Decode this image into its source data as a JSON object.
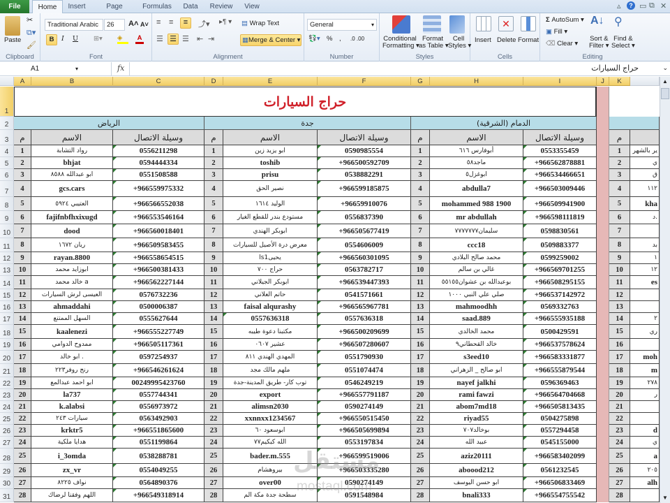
{
  "ribbon_tabs": [
    "File",
    "Home",
    "Insert",
    "Page Layout",
    "Formulas",
    "Data",
    "Review",
    "View"
  ],
  "active_tab": "Home",
  "clipboard": {
    "paste": "Paste",
    "label": "Clipboard"
  },
  "font": {
    "name": "Traditional Arabic",
    "size": "26",
    "label": "Font",
    "bold": "B",
    "italic": "I",
    "underline": "U",
    "grow": "A˄",
    "shrink": "A˅",
    "color": "A"
  },
  "alignment": {
    "wrap": "Wrap Text",
    "merge": "Merge & Center",
    "label": "Alignment"
  },
  "number": {
    "format": "General",
    "label": "Number",
    "percent": "%",
    "comma": ",",
    "inc": ".0 .00",
    "dec": ".00 .0"
  },
  "styles": {
    "conditional": "Conditional",
    "conditional2": "Formatting ▾",
    "format_table": "Format",
    "format_table2": "as Table ▾",
    "cell_styles": "Cell",
    "cell_styles2": "Styles ▾",
    "label": "Styles"
  },
  "cells": {
    "insert": "Insert",
    "delete": "Delete",
    "format": "Format",
    "label": "Cells"
  },
  "editing": {
    "autosum": "AutoSum ▾",
    "fill": "Fill ▾",
    "clear": "Clear ▾",
    "sort": "Sort &",
    "sort2": "Filter ▾",
    "find": "Find &",
    "find2": "Select ▾",
    "label": "Editing"
  },
  "formula_bar": {
    "name_box": "A1",
    "fx": "fx",
    "content": "حراج السيارات"
  },
  "columns": [
    "A",
    "B",
    "C",
    "D",
    "E",
    "F",
    "G",
    "H",
    "I",
    "J",
    "K"
  ],
  "sheet": {
    "title": "حراج السيارات",
    "headers": {
      "num": "م",
      "name": "الاسم",
      "contact": "وسيلة الاتصال"
    },
    "sections": [
      {
        "city": "الرياض",
        "rows": [
          [
            "1",
            "رواد التشابة",
            "0556211298"
          ],
          [
            "2",
            "bhjat",
            "0594444334"
          ],
          [
            "3",
            "ابو عبدالله ٨٥٨٨",
            "0551508588"
          ],
          [
            "4",
            "gcs.cars",
            "+966559975332"
          ],
          [
            "5",
            "العتيبي ٥٩٢٤",
            "+966566552038"
          ],
          [
            "6",
            "fajifnbfhxixugd",
            "+966553546164"
          ],
          [
            "7",
            "dood",
            "+966560018401"
          ],
          [
            "8",
            "ريان ١٦٧٢",
            "+966509583455"
          ],
          [
            "9",
            "rayan.8800",
            "+966558654515"
          ],
          [
            "10",
            "ابوزايد محمد",
            "+966500381433"
          ],
          [
            "11",
            "خالد محمد a",
            "+966562227144"
          ],
          [
            "12",
            "العيسى لرش السيارات",
            "0576732236"
          ],
          [
            "13",
            "ahmaddahi",
            "0500006387"
          ],
          [
            "14",
            "السهل الممتنع",
            "0555627644"
          ],
          [
            "15",
            "kaalenezi",
            "+966555227749"
          ],
          [
            "16",
            "ممدوح الدوامي",
            "+966505117361"
          ],
          [
            "17",
            "ابو خالد .",
            "0597254937"
          ],
          [
            "18",
            "رنج روفر٢٢٣",
            "+966546261624"
          ],
          [
            "19",
            "ابو احمد عبدالمع",
            "00249995423760"
          ],
          [
            "20",
            "la737",
            "0557744341"
          ],
          [
            "21",
            "k.alabsi",
            "0556973972"
          ],
          [
            "22",
            "سيارات ٢٤٣",
            "0563492903"
          ],
          [
            "23",
            "krktr5",
            "+966551865600"
          ],
          [
            "24",
            "هدايا ملكية",
            "0551199864"
          ],
          [
            "25",
            "i_3omda",
            "0538288781"
          ],
          [
            "26",
            "zx_vr",
            "0554049255"
          ],
          [
            "27",
            "نواف ٨٢٢٥",
            "0564890376"
          ],
          [
            "28",
            "اللهم وفقنا لرضاك",
            "+966549318914"
          ]
        ]
      },
      {
        "city": "جدة",
        "rows": [
          [
            "1",
            "ابو يزيد زين",
            "0590985554"
          ],
          [
            "2",
            "toshib",
            "+966500592709"
          ],
          [
            "3",
            "prisu",
            "0538882291"
          ],
          [
            "4",
            "نصير الحق",
            "+966599185875"
          ],
          [
            "5",
            "الوليد ١٦١٤",
            "+96659910076"
          ],
          [
            "6",
            "مستودع بندر للقطع الغيار",
            "0556837390"
          ],
          [
            "7",
            "ابوبكر الهندي",
            "+966505677419"
          ],
          [
            "8",
            "معرض درة الأصيل للسيارات",
            "0554606009"
          ],
          [
            "9",
            "ls1يحيى",
            "+966560301095"
          ],
          [
            "10",
            "حراج ٧٠٠",
            "0563782717"
          ],
          [
            "11",
            "ابوبكر الجيلاني",
            "+966539447393"
          ],
          [
            "12",
            "حاتم العلاني",
            "0541571661"
          ],
          [
            "13",
            "faisal alqurashy",
            "+966565967781"
          ],
          [
            "14",
            "0557636318",
            "0557636318"
          ],
          [
            "15",
            "مكتبنا دعوة طيبه",
            "+966500209699"
          ],
          [
            "16",
            "عشير ٠٦٠٧",
            "+966507280607"
          ],
          [
            "17",
            "المهدي الهندي ٨١١",
            "0551790930"
          ],
          [
            "18",
            "ملهم مالك مجد",
            "0551074474"
          ],
          [
            "19",
            "توب كار- طريق المدينة-جدة",
            "0546249219"
          ],
          [
            "20",
            "export",
            "+966557791187"
          ],
          [
            "21",
            "alimsn2030",
            "0590274149"
          ],
          [
            "22",
            "xxnnxx1234567",
            "+966550515450"
          ],
          [
            "23",
            "ابوسعود ٦٠",
            "+966505699894"
          ],
          [
            "24",
            "الله كبكيم٧٧",
            "0553197834"
          ],
          [
            "25",
            "bader.m.555",
            "+966599519006"
          ],
          [
            "26",
            "بيروهشام",
            "+966503335280"
          ],
          [
            "27",
            "over00",
            "0590274149"
          ],
          [
            "28",
            "سطحة جدة مكة الم",
            "0591548984"
          ]
        ]
      },
      {
        "city": "الدمام (الشرقية)",
        "rows": [
          [
            "1",
            "أبوفارس ٦١٦",
            "0553355459"
          ],
          [
            "2",
            "ماجد٥٨",
            "+966562878881"
          ],
          [
            "3",
            "ابوغزل٥",
            "+966534466651"
          ],
          [
            "4",
            "abdulla7",
            "+966503009446"
          ],
          [
            "5",
            "mohammed 988 1900",
            "+966509941900"
          ],
          [
            "6",
            "mr abdullah",
            "+966598111819"
          ],
          [
            "7",
            "سليمان٧٧٧٧٧٧٧",
            "0598830561"
          ],
          [
            "8",
            "ccc18",
            "0509883377"
          ],
          [
            "9",
            "محمد صالح البلادي",
            "0599259002"
          ],
          [
            "10",
            "غالي بن سالم",
            "+966569701255"
          ],
          [
            "11",
            "بوعبدالله بن عشوان٥٥١٥٥",
            "+966508295155"
          ],
          [
            "12",
            "صلي علي النبي ١٠٠٠",
            "+966537142972"
          ],
          [
            "13",
            "mahmoodhh",
            "0569332763"
          ],
          [
            "14",
            "saad.889",
            "+966555935188"
          ],
          [
            "15",
            "محمد الخالدي",
            "0500429591"
          ],
          [
            "16",
            "خالد القحطاني٩",
            "+966537578624"
          ],
          [
            "17",
            "s3eed10",
            "+966583331877"
          ],
          [
            "18",
            "ابو صالح _ الزهراني",
            "+966555879544"
          ],
          [
            "19",
            "nayef jalkhi",
            "0596369463"
          ],
          [
            "20",
            "rami fawzi",
            "+966564704668"
          ],
          [
            "21",
            "abom7md18",
            "+966505813435"
          ],
          [
            "22",
            "riyad55",
            "0504275898"
          ],
          [
            "23",
            "بوخالد٧٠٧",
            "0557294458"
          ],
          [
            "24",
            "عبيد الله",
            "0545155000"
          ],
          [
            "25",
            "aziz20111",
            "+966583402099"
          ],
          [
            "26",
            "aboood212",
            "0561232545"
          ],
          [
            "27",
            "ابو حسن اليوسف",
            "+966506833469"
          ],
          [
            "28",
            "bnali333",
            "+966554755542"
          ]
        ]
      },
      {
        "city": "",
        "rows": [
          [
            "1",
            "ير بالشهر",
            ""
          ],
          [
            "2",
            "ي",
            ""
          ],
          [
            "3",
            "ق",
            ""
          ],
          [
            "4",
            "١١٢",
            ""
          ],
          [
            "5",
            "kha",
            ""
          ],
          [
            "6",
            "د.",
            ""
          ],
          [
            "7",
            "",
            ""
          ],
          [
            "8",
            "بد",
            ""
          ],
          [
            "9",
            "١",
            ""
          ],
          [
            "10",
            "١٢",
            ""
          ],
          [
            "11",
            "es",
            ""
          ],
          [
            "12",
            "",
            ""
          ],
          [
            "13",
            "",
            ""
          ],
          [
            "14",
            "٢",
            ""
          ],
          [
            "15",
            "ري",
            ""
          ],
          [
            "16",
            "",
            ""
          ],
          [
            "17",
            "moh",
            ""
          ],
          [
            "18",
            "m",
            ""
          ],
          [
            "19",
            "٢٧٨",
            ""
          ],
          [
            "20",
            "ر",
            ""
          ],
          [
            "21",
            "",
            ""
          ],
          [
            "22",
            "",
            ""
          ],
          [
            "23",
            "d",
            ""
          ],
          [
            "24",
            "ي",
            ""
          ],
          [
            "25",
            "a",
            ""
          ],
          [
            "26",
            "٢٠٥",
            ""
          ],
          [
            "27",
            "alh",
            ""
          ],
          [
            "28",
            "",
            ""
          ]
        ]
      }
    ]
  },
  "watermark": {
    "text": "مستقل",
    "url": "mostaql.com"
  }
}
